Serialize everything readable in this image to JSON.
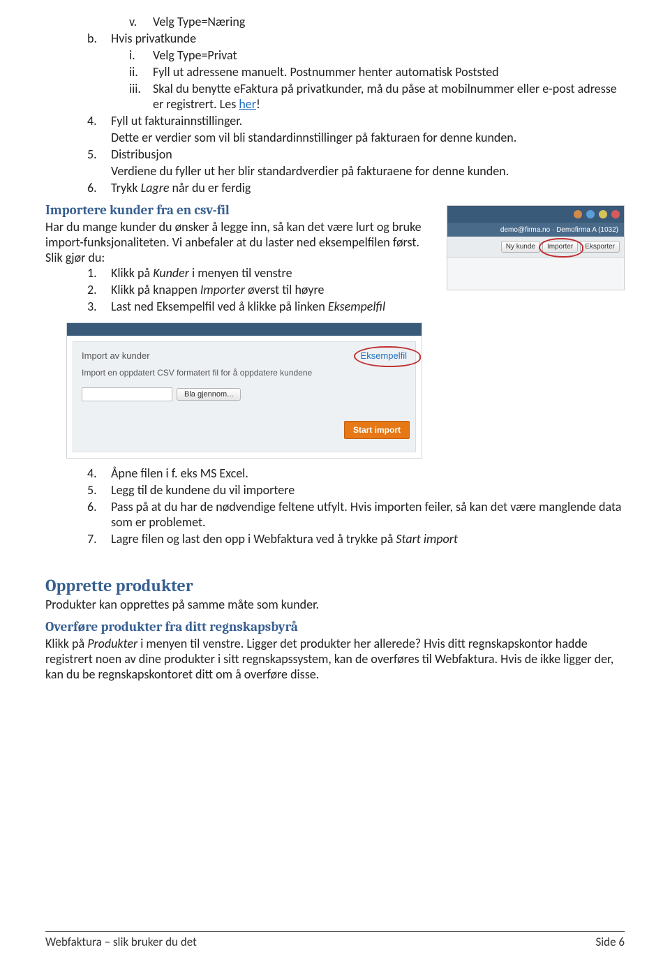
{
  "list1": {
    "v": {
      "n": "v.",
      "t": "Velg Type=Næring"
    },
    "b": {
      "n": "b.",
      "t": "Hvis privatkunde"
    },
    "i1": {
      "n": "i.",
      "t": "Velg Type=Privat"
    },
    "i2": {
      "n": "ii.",
      "t": "Fyll ut adressene manuelt. Postnummer henter automatisk Poststed"
    },
    "i3": {
      "n": "iii.",
      "t_pre": "Skal du benytte eFaktura på privatkunder, må du påse at mobilnummer eller e-post adresse er registrert. Les ",
      "link": "her",
      "t_post": "!"
    },
    "n4": {
      "n": "4.",
      "t": "Fyll ut fakturainnstillinger.",
      "cont": "Dette er verdier som vil bli standardinnstillinger på fakturaen for denne kunden."
    },
    "n5": {
      "n": "5.",
      "t": "Distribusjon",
      "cont": "Verdiene du fyller ut her blir standardverdier på fakturaene for denne kunden."
    },
    "n6": {
      "n": "6.",
      "t_pre": "Trykk ",
      "em": "Lagre",
      "t_post": " når du er ferdig"
    }
  },
  "sec1": {
    "heading": "Importere kunder fra en csv-fil",
    "p1": "Har du mange kunder du ønsker å legge inn, så kan det være lurt og bruke import-funksjonaliteten. Vi anbefaler at du laster ned eksempelfilen først.",
    "p2": "Slik gjør du:",
    "li1": {
      "n": "1.",
      "pre": "Klikk på ",
      "em": "Kunder",
      "post": " i menyen til venstre"
    },
    "li2": {
      "n": "2.",
      "pre": "Klikk på knappen ",
      "em": "Importer",
      "post": " øverst til høyre"
    },
    "li3": {
      "n": "3.",
      "pre": "Last ned Eksempelfil ved å klikke på linken ",
      "em": "Eksempelfil",
      "post": ""
    }
  },
  "shot1": {
    "sub": "demo@firma.no · Demofirma A (1032)",
    "b1": "Ny kunde",
    "b2": "Importer",
    "b3": "Eksporter"
  },
  "shot2": {
    "title": "Import av kunder",
    "link": "Eksempelfil",
    "desc": "Import en oppdatert CSV formatert fil for å oppdatere kundene",
    "browse": "Bla gjennom...",
    "start": "Start import"
  },
  "list2": {
    "li4": {
      "n": "4.",
      "t": "Åpne filen i f. eks MS Excel."
    },
    "li5": {
      "n": "5.",
      "t": "Legg til de kundene du vil importere"
    },
    "li6": {
      "n": "6.",
      "t": "Pass på at du har de nødvendige feltene utfylt. Hvis importen feiler, så kan det være manglende data som er problemet."
    },
    "li7": {
      "n": "7.",
      "pre": "Lagre filen og last den opp i Webfaktura ved å trykke på ",
      "em": "Start import",
      "post": ""
    }
  },
  "sec2": {
    "heading": "Opprette produkter",
    "p": "Produkter kan opprettes på samme måte som kunder."
  },
  "sec3": {
    "heading": "Overføre produkter fra ditt regnskapsbyrå",
    "p_pre": "Klikk på ",
    "p_em": "Produkter",
    "p_post": " i menyen til venstre. Ligger det produkter her allerede? Hvis ditt regnskapskontor hadde registrert noen av dine produkter i sitt regnskapssystem, kan de overføres til Webfaktura. Hvis de ikke ligger der, kan du be regnskapskontoret ditt om å overføre disse."
  },
  "footer": {
    "left": "Webfaktura – slik bruker du det",
    "right": "Side 6"
  }
}
